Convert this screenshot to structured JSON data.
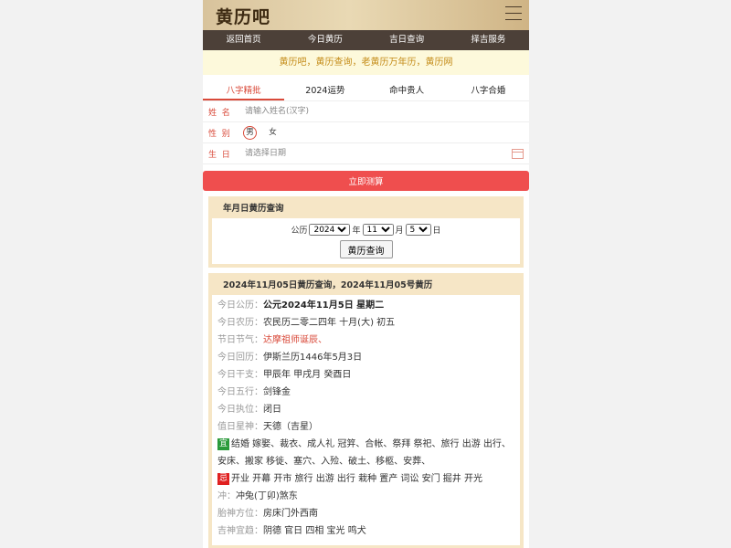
{
  "header": {
    "logo": "黄历吧"
  },
  "nav": [
    "返回首页",
    "今日黄历",
    "吉日查询",
    "择吉服务"
  ],
  "banner": "黄历吧，黄历查询，老黄历万年历，黄历网",
  "tabs": [
    {
      "label": "八字精批",
      "active": true
    },
    {
      "label": "2024运势",
      "active": false
    },
    {
      "label": "命中贵人",
      "active": false
    },
    {
      "label": "八字合婚",
      "active": false
    }
  ],
  "form": {
    "name_label": "姓  名",
    "name_placeholder": "请输入姓名(汉字)",
    "gender_label": "性  别",
    "male": "男",
    "female": "女",
    "birth_label": "生  日",
    "birth_placeholder": "请选择日期",
    "submit": "立即测算"
  },
  "query": {
    "title": "年月日黄历查询",
    "prefix": "公历",
    "year": "2024",
    "year_unit": "年",
    "month": "11",
    "month_unit": "月",
    "day": "5",
    "day_unit": "日",
    "button": "黄历查询"
  },
  "detail": {
    "title": "2024年11月05日黄历查询，2024年11月05号黄历",
    "gongli_k": "今日公历：",
    "gongli_v": "公元2024年11月5日 星期二",
    "nongli_k": "今日农历：",
    "nongli_v": "农民历二零二四年 十月(大) 初五",
    "jieqi_k": "节日节气：",
    "jieqi_v": "达摩祖师诞辰、",
    "huili_k": "今日回历：",
    "huili_v": "伊斯兰历1446年5月3日",
    "ganzhi_k": "今日干支：",
    "ganzhi_v": "甲辰年 甲戌月 癸酉日",
    "wuxing_k": "今日五行：",
    "wuxing_v": "剑锋金",
    "zhiri_k": "今日执位：",
    "zhiri_v": "闭日",
    "xingshen_k": "值日星神：",
    "xingshen_v": "天德（吉星）",
    "yi_tag": "宜",
    "yi_v": "结婚 嫁娶、裁衣、成人礼 冠笄、合帐、祭拜 祭祀、旅行 出游 出行、安床、搬家 移徙、塞穴、入殓、破土、移柩、安葬、",
    "ji_tag": "忌",
    "ji_v": "开业 开幕 开市 旅行 出游 出行 栽种 置产 词讼 安门 掘井 开光",
    "chong_k": "冲：",
    "chong_v": "冲兔(丁卯)煞东",
    "taishen_k": "胎神方位：",
    "taishen_v": "房床门外西南",
    "jishen_k": "吉神宜趋：",
    "jishen_v": "阴德 官日 四相 宝光 鸣犬"
  }
}
